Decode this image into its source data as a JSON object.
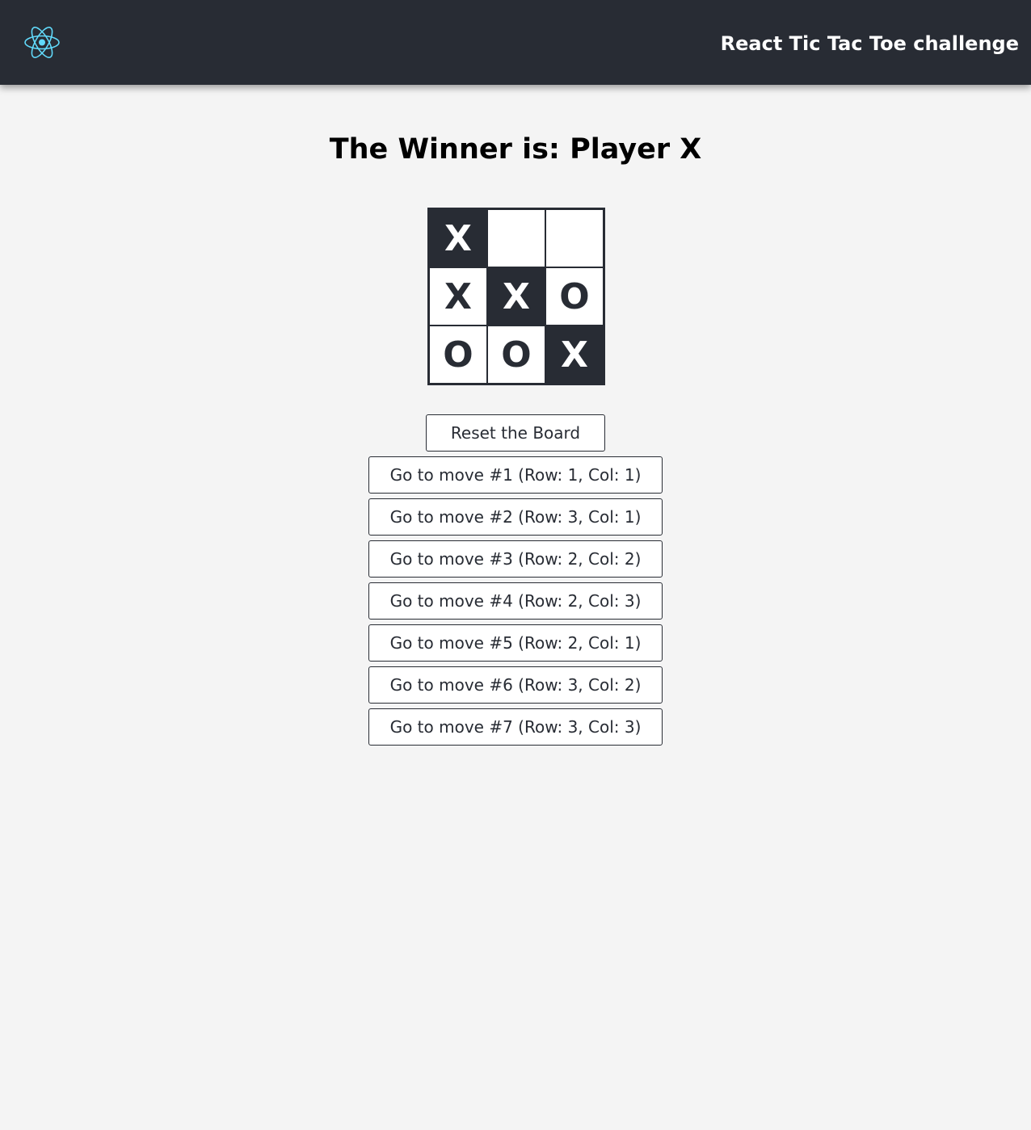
{
  "header": {
    "logo_icon": "react-logo-icon",
    "logo_color": "#61dafb",
    "title": "React Tic Tac Toe challenge",
    "background": "#282c34"
  },
  "status": {
    "text": "The Winner is: Player X"
  },
  "board": {
    "cells": [
      {
        "value": "X",
        "winning": true
      },
      {
        "value": "",
        "winning": false
      },
      {
        "value": "",
        "winning": false
      },
      {
        "value": "X",
        "winning": false
      },
      {
        "value": "X",
        "winning": true
      },
      {
        "value": "O",
        "winning": false
      },
      {
        "value": "O",
        "winning": false
      },
      {
        "value": "O",
        "winning": false
      },
      {
        "value": "X",
        "winning": true
      }
    ]
  },
  "controls": {
    "reset_label": "Reset the Board",
    "moves": [
      "Go to move #1 (Row: 1, Col: 1)",
      "Go to move #2 (Row: 3, Col: 1)",
      "Go to move #3 (Row: 2, Col: 2)",
      "Go to move #4 (Row: 2, Col: 3)",
      "Go to move #5 (Row: 2, Col: 1)",
      "Go to move #6 (Row: 3, Col: 2)",
      "Go to move #7 (Row: 3, Col: 3)"
    ]
  }
}
